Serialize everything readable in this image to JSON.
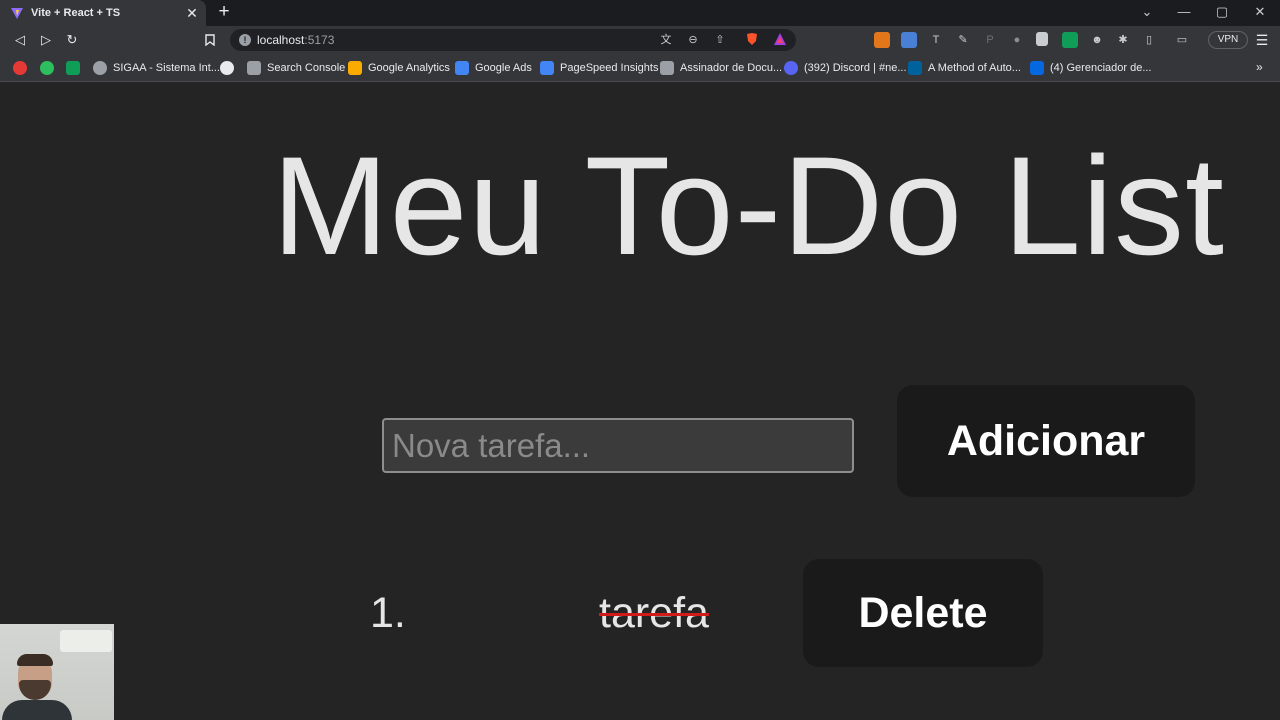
{
  "browser": {
    "tab": {
      "title": "Vite + React + TS",
      "close": "✕"
    },
    "new_tab": "+",
    "window_controls": {
      "dropdown": "⌄",
      "minimize": "—",
      "maximize": "▢",
      "close": "✕"
    },
    "nav": {
      "back": "◁",
      "forward": "▷",
      "reload": "↻",
      "bookmark": "🔖"
    },
    "url": {
      "host": "localhost",
      "port": ":5173"
    },
    "vpn_label": "VPN",
    "menu": "☰",
    "bookmarks": [
      {
        "label": "",
        "icon": "youtube-icon",
        "color": "#e53935"
      },
      {
        "label": "",
        "icon": "evernote-icon",
        "color": "#2dbe60"
      },
      {
        "label": "",
        "icon": "sheets-icon",
        "color": "#0f9d58"
      },
      {
        "label": "SIGAA - Sistema Int...",
        "icon": "globe-icon",
        "color": "#9aa0a6"
      },
      {
        "label": "",
        "icon": "github-icon",
        "color": "#e8eaed"
      },
      {
        "label": "Search Console",
        "icon": "search-console-icon",
        "color": "#9aa0a6"
      },
      {
        "label": "Google Analytics",
        "icon": "analytics-icon",
        "color": "#f9ab00"
      },
      {
        "label": "Google Ads",
        "icon": "ads-icon",
        "color": "#4285f4"
      },
      {
        "label": "PageSpeed Insights",
        "icon": "pagespeed-icon",
        "color": "#4285f4"
      },
      {
        "label": "Assinador de Docu...",
        "icon": "signer-icon",
        "color": "#9aa0a6"
      },
      {
        "label": "(392) Discord | #ne...",
        "icon": "discord-icon",
        "color": "#5865f2"
      },
      {
        "label": "A Method of Auto...",
        "icon": "ieee-icon",
        "color": "#00629b"
      },
      {
        "label": "(4) Gerenciador de...",
        "icon": "meta-icon",
        "color": "#0668e1"
      }
    ],
    "bookmarks_more": "»"
  },
  "app": {
    "title": "Meu To-Do List",
    "input_placeholder": "Nova tarefa...",
    "add_label": "Adicionar",
    "todos": [
      {
        "number": "1.",
        "text": "tarefa",
        "completed": true,
        "delete_label": "Delete"
      }
    ]
  },
  "colors": {
    "page_bg": "#242424",
    "button_bg": "#1a1a1a",
    "text": "#e6e6e6",
    "strike": "#d11a1a"
  }
}
